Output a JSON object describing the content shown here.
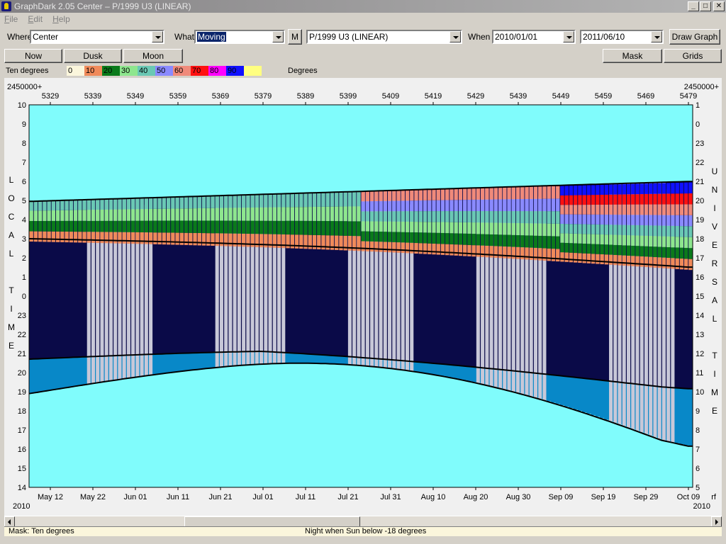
{
  "window": {
    "title": "GraphDark 2.05  Center  –  P/1999 U3 (LINEAR)",
    "controls": [
      "_",
      "□",
      "✕"
    ]
  },
  "menu": [
    "File",
    "Edit",
    "Help"
  ],
  "toolbar": {
    "where_label": "Where",
    "where_value": "Center",
    "what_label": "What",
    "what_value": "Moving",
    "m_button": "M",
    "object_value": "P/1999 U3 (LINEAR)",
    "when_label": "When",
    "start_date": "2010/01/01",
    "end_date": "2011/06/10",
    "draw_button": "Draw Graph",
    "now_button": "Now",
    "dusk_button": "Dusk",
    "moon_button": "Moon",
    "mask_button": "Mask",
    "grids_button": "Grids"
  },
  "legend": {
    "label": "Ten degrees",
    "units": "Degrees",
    "items": [
      {
        "text": "0",
        "color": "#fbf6dc"
      },
      {
        "text": "10",
        "color": "#f08a5a"
      },
      {
        "text": "20",
        "color": "#0a7a1a"
      },
      {
        "text": "30",
        "color": "#8ee68e"
      },
      {
        "text": "40",
        "color": "#6ac8b4"
      },
      {
        "text": "50",
        "color": "#8a8aff"
      },
      {
        "text": "60",
        "color": "#f08a7a"
      },
      {
        "text": "70",
        "color": "#ff1010"
      },
      {
        "text": "80",
        "color": "#ff00ff"
      },
      {
        "text": "90",
        "color": "#1010ff"
      },
      {
        "text": "",
        "color": "#ffff80"
      }
    ]
  },
  "chart_data": {
    "type": "heatmap",
    "jd_prefix_left": "2450000+",
    "jd_prefix_right": "2450000+",
    "jd_ticks": [
      "5329",
      "5339",
      "5349",
      "5359",
      "5369",
      "5379",
      "5389",
      "5399",
      "5409",
      "5419",
      "5429",
      "5439",
      "5449",
      "5459",
      "5469",
      "5479"
    ],
    "date_ticks": [
      "May 12",
      "May 22",
      "Jun 01",
      "Jun 11",
      "Jun 21",
      "Jul 01",
      "Jul 11",
      "Jul 21",
      "Jul 31",
      "Aug 10",
      "Aug 20",
      "Aug 30",
      "Sep 09",
      "Sep 19",
      "Sep 29",
      "Oct 09"
    ],
    "year_left": "2010",
    "year_right": "2010",
    "right_corner": "rf",
    "left_axis_ticks": [
      "10",
      "9",
      "8",
      "7",
      "6",
      "5",
      "4",
      "3",
      "2",
      "1",
      "0",
      "23",
      "22",
      "21",
      "20",
      "19",
      "18",
      "17",
      "16",
      "15",
      "14"
    ],
    "right_axis_ticks": [
      "1",
      "0",
      "23",
      "22",
      "21",
      "20",
      "19",
      "18",
      "17",
      "16",
      "15",
      "14",
      "13",
      "12",
      "11",
      "10",
      "9",
      "8",
      "7",
      "6",
      "5"
    ],
    "left_axis_label": "LOCAL TIME",
    "right_axis_label": "UNIVERSAL TIME",
    "colors": {
      "day": "#80fcfc",
      "night": "#0a0a48",
      "twilight": "#0888c8",
      "moon": "#c8c8d8"
    }
  },
  "status": {
    "mask": "Mask:  Ten degrees",
    "night": "Night when Sun below -18 degrees"
  }
}
